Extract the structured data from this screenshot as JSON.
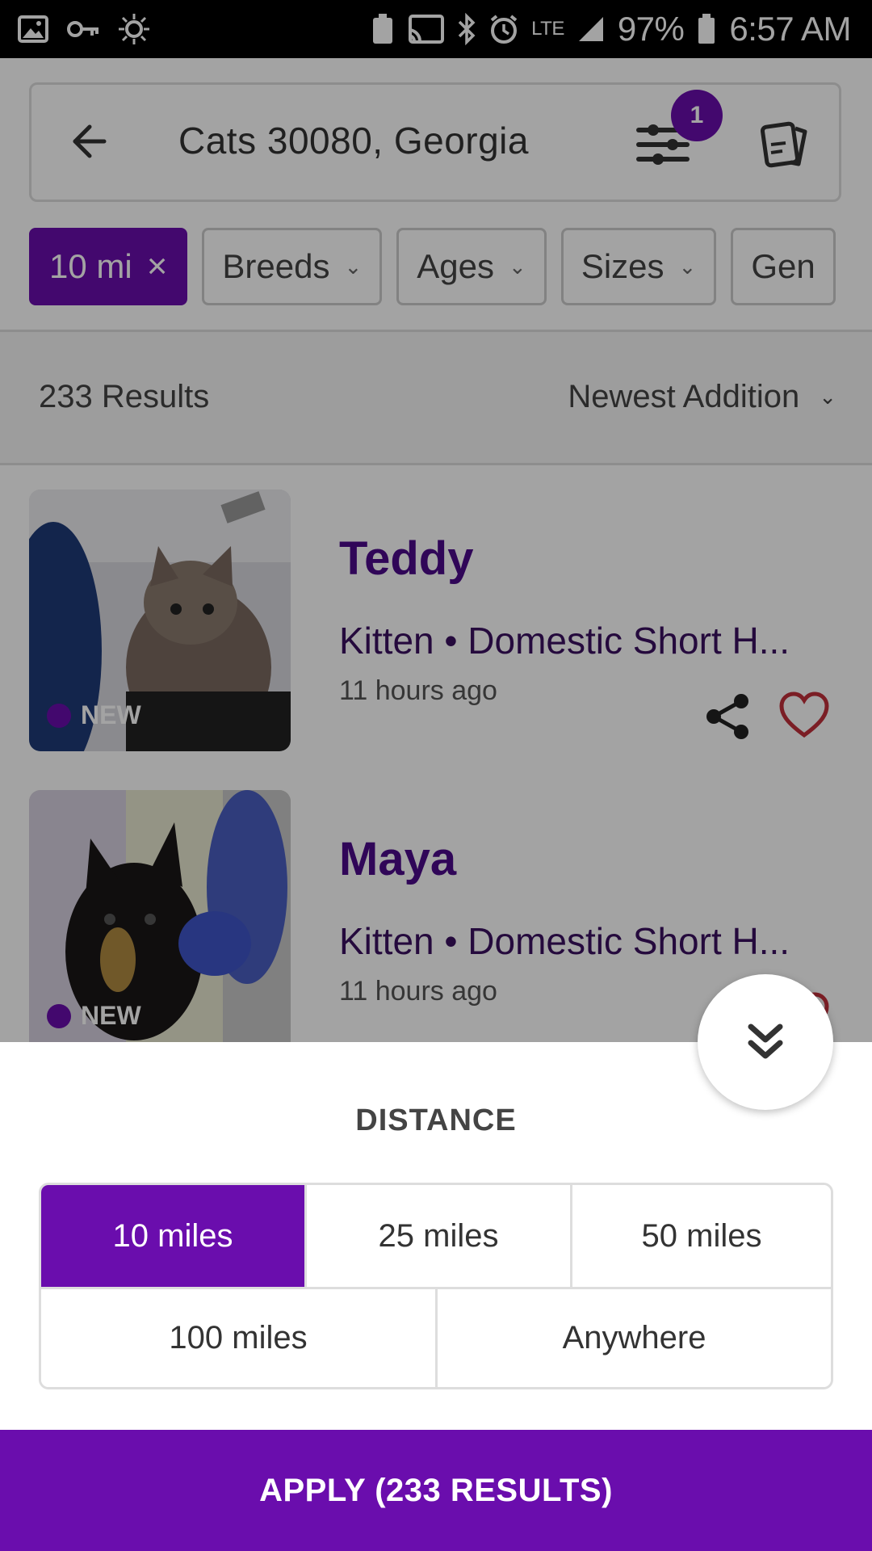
{
  "status_bar": {
    "network": "LTE",
    "battery": "97%",
    "time": "6:57 AM"
  },
  "search": {
    "title": "Cats 30080, Georgia",
    "filter_badge": "1"
  },
  "chips": [
    {
      "label": "10 mi",
      "active": true
    },
    {
      "label": "Breeds"
    },
    {
      "label": "Ages"
    },
    {
      "label": "Sizes"
    },
    {
      "label": "Gen"
    }
  ],
  "results": {
    "count": "233 Results",
    "sort": "Newest Addition"
  },
  "listings": [
    {
      "name": "Teddy",
      "info": "Kitten • Domestic Short H...",
      "time": "11 hours ago",
      "badge": "NEW"
    },
    {
      "name": "Maya",
      "info": "Kitten • Domestic Short H...",
      "time": "11 hours ago",
      "badge": "NEW"
    }
  ],
  "sheet": {
    "title": "DISTANCE",
    "options": [
      "10 miles",
      "25 miles",
      "50 miles",
      "100 miles",
      "Anywhere"
    ],
    "selected": "10 miles",
    "apply_label": "APPLY (233 RESULTS)"
  },
  "colors": {
    "accent": "#6a0dad",
    "pet_name": "#4b0a8a",
    "heart": "#c0303a"
  }
}
